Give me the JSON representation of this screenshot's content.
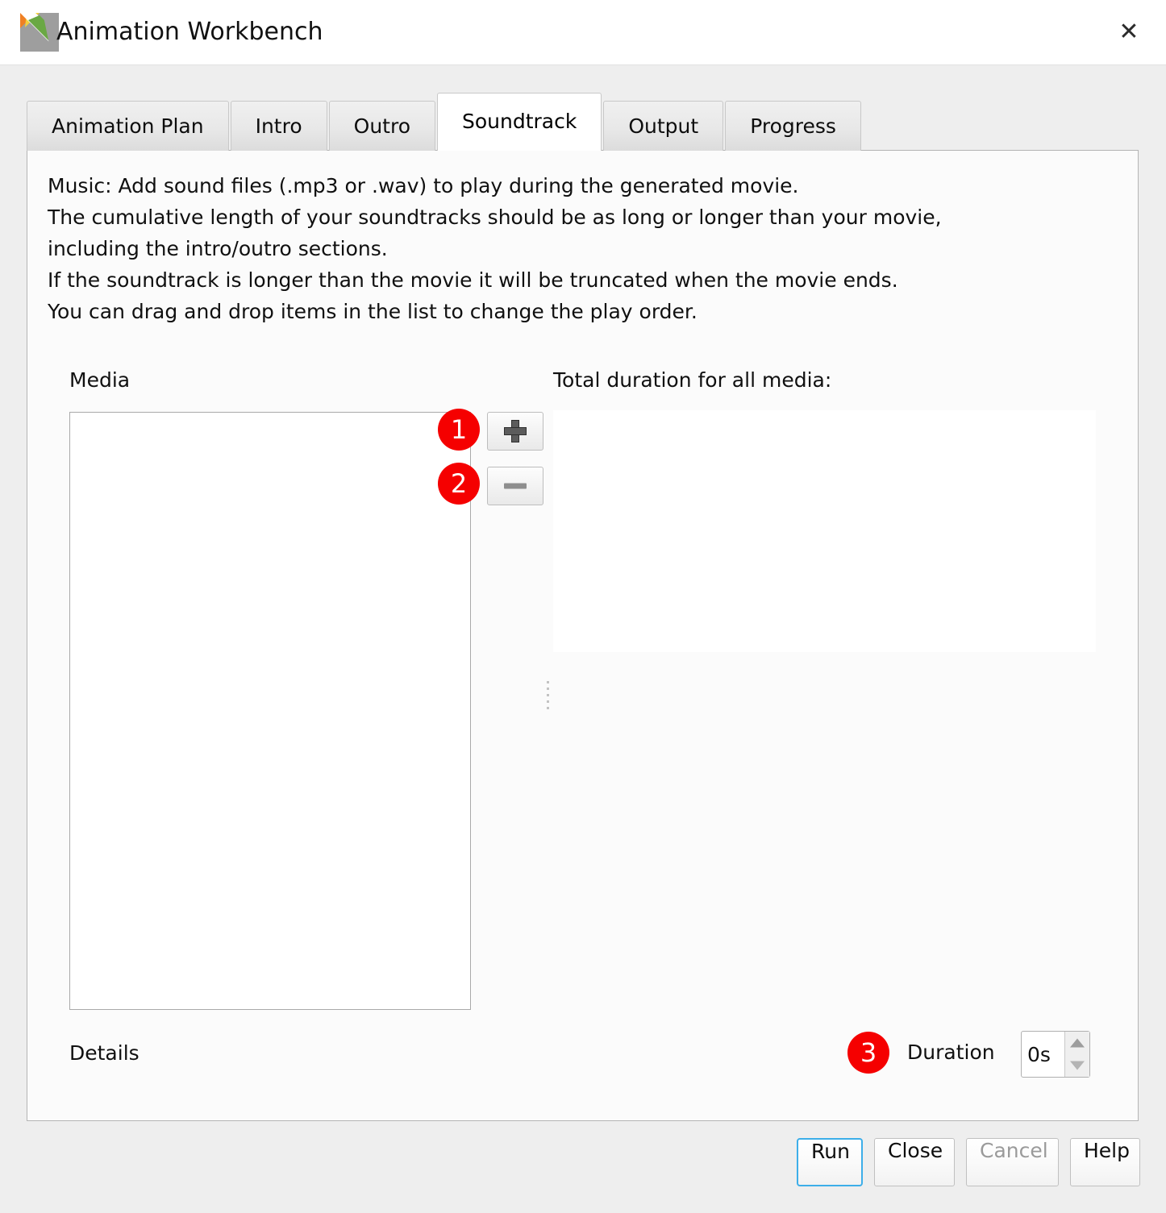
{
  "window": {
    "title": "Animation Workbench",
    "logo_icon": "animation-workbench-logo",
    "close_icon": "close-icon",
    "close_glyph": "✕"
  },
  "tabs": [
    {
      "label": "Animation Plan",
      "active": false
    },
    {
      "label": "Intro",
      "active": false
    },
    {
      "label": "Outro",
      "active": false
    },
    {
      "label": "Soundtrack",
      "active": true
    },
    {
      "label": "Output",
      "active": false
    },
    {
      "label": "Progress",
      "active": false
    }
  ],
  "soundtrack": {
    "intro_text": "Music: Add sound files (.mp3 or .wav) to play during the generated movie.\nThe cumulative length of your soundtracks should be as long or longer than your movie,\nincluding the intro/outro sections.\nIf the soundtrack is longer than the movie it will be truncated when the movie ends.\nYou can drag and drop items in the list to change the play order.",
    "media_label": "Media",
    "total_duration_label": "Total duration for all media:",
    "details_label": "Details",
    "media_items": [],
    "total_duration_value": "",
    "add_button": {
      "icon": "plus-icon",
      "label": ""
    },
    "remove_button": {
      "icon": "minus-icon",
      "label": ""
    },
    "duration": {
      "label": "Duration",
      "value": "0s",
      "up_icon": "caret-up-icon",
      "down_icon": "caret-down-icon"
    }
  },
  "dialog_buttons": [
    {
      "label": "Run",
      "enabled": true,
      "focused": true
    },
    {
      "label": "Close",
      "enabled": true,
      "focused": false
    },
    {
      "label": "Cancel",
      "enabled": false,
      "focused": false
    },
    {
      "label": "Help",
      "enabled": true,
      "focused": false
    }
  ],
  "annotations": [
    {
      "number": "1",
      "target": "add-media-button"
    },
    {
      "number": "2",
      "target": "remove-media-button"
    },
    {
      "number": "3",
      "target": "duration-spinner"
    }
  ],
  "colors": {
    "annotation_badge": "#f50000",
    "focus_outline": "#3daee9",
    "panel_background": "#fbfbfb",
    "window_background": "#eeeeee",
    "disabled_text": "#9a9a9a"
  }
}
